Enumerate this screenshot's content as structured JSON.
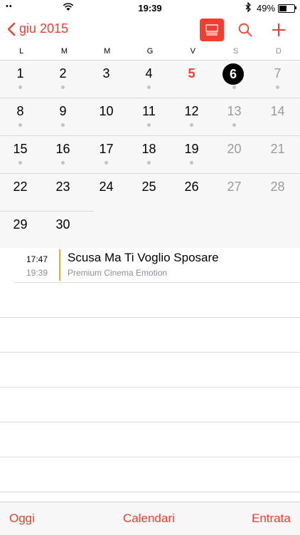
{
  "status_bar": {
    "carrier": "••",
    "time": "19:39",
    "battery_percent": "49%",
    "battery_level": 0.49
  },
  "header": {
    "back_label": "giu 2015"
  },
  "weekdays": [
    "L",
    "M",
    "M",
    "G",
    "V",
    "S",
    "D"
  ],
  "calendar": {
    "weeks": [
      [
        {
          "day": "1",
          "dot": true
        },
        {
          "day": "2",
          "dot": true
        },
        {
          "day": "3",
          "dot": false
        },
        {
          "day": "4",
          "dot": true
        },
        {
          "day": "5",
          "dot": false,
          "style": "today"
        },
        {
          "day": "6",
          "dot": true,
          "style": "selected"
        },
        {
          "day": "7",
          "dot": true,
          "style": "weekend"
        }
      ],
      [
        {
          "day": "8",
          "dot": true
        },
        {
          "day": "9",
          "dot": true
        },
        {
          "day": "10",
          "dot": false
        },
        {
          "day": "11",
          "dot": true
        },
        {
          "day": "12",
          "dot": true
        },
        {
          "day": "13",
          "dot": true,
          "style": "weekend"
        },
        {
          "day": "14",
          "dot": false,
          "style": "weekend"
        }
      ],
      [
        {
          "day": "15",
          "dot": true
        },
        {
          "day": "16",
          "dot": true
        },
        {
          "day": "17",
          "dot": true
        },
        {
          "day": "18",
          "dot": true
        },
        {
          "day": "19",
          "dot": true
        },
        {
          "day": "20",
          "dot": false,
          "style": "weekend"
        },
        {
          "day": "21",
          "dot": false,
          "style": "weekend"
        }
      ],
      [
        {
          "day": "22",
          "dot": false
        },
        {
          "day": "23",
          "dot": false
        },
        {
          "day": "24",
          "dot": false
        },
        {
          "day": "25",
          "dot": false
        },
        {
          "day": "26",
          "dot": false
        },
        {
          "day": "27",
          "dot": false,
          "style": "weekend"
        },
        {
          "day": "28",
          "dot": false,
          "style": "weekend"
        }
      ],
      [
        {
          "day": "29",
          "dot": false
        },
        {
          "day": "30",
          "dot": false
        }
      ]
    ]
  },
  "event": {
    "start": "17:47",
    "end": "19:39",
    "title": "Scusa Ma Ti Voglio Sposare",
    "location": "Premium Cinema Emotion",
    "color": "#f5a623"
  },
  "toolbar": {
    "today": "Oggi",
    "calendars": "Calendari",
    "inbox": "Entrata"
  },
  "colors": {
    "accent": "#f23d30"
  }
}
